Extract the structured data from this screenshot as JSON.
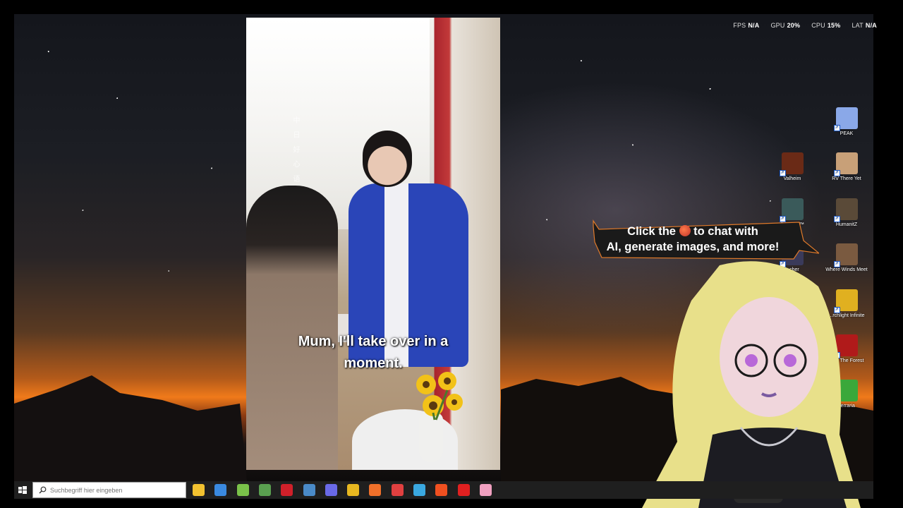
{
  "hud": {
    "fps_label": "FPS",
    "fps_value": "N/A",
    "gpu_label": "GPU",
    "gpu_value": "20%",
    "cpu_label": "CPU",
    "cpu_value": "15%",
    "lat_label": "LAT",
    "lat_value": "N/A"
  },
  "video": {
    "subtitle_line1": "Mum, I'll take over in a",
    "subtitle_line2": "moment.",
    "vertical_text": "中 日 好 心 语"
  },
  "desktop_icons": [
    {
      "label": "PEAK",
      "color": "#8aa8e8"
    },
    {
      "label": "Valheim",
      "color": "#6a2a16"
    },
    {
      "label": "RV There Yet",
      "color": "#c8a078"
    },
    {
      "label": "Returnal™",
      "color": "#3a5a5a"
    },
    {
      "label": "HumanitZ",
      "color": "#5a4a38"
    },
    {
      "label": "...cher",
      "color": "#3a3a5a"
    },
    {
      "label": "Where Winds Meet",
      "color": "#7a5a40"
    },
    {
      "label": "...rchlight Infinite",
      "color": "#e0b020"
    },
    {
      "label": "...Of The Forest",
      "color": "#b01a1a"
    },
    {
      "label": "Terraria",
      "color": "#3aa83a"
    }
  ],
  "assistant": {
    "bubble_line1_a": "Click the",
    "bubble_line1_b": "to chat with",
    "bubble_line2": "AI, generate images, and more!",
    "bubble_icon": "basketball-icon"
  },
  "taskbar": {
    "search_placeholder": "Suchbegriff hier eingeben",
    "apps": [
      {
        "name": "file-explorer-icon",
        "color": "#f2c230"
      },
      {
        "name": "store-icon",
        "color": "#3a8ae0"
      },
      {
        "name": "android-icon",
        "color": "#7ac24a"
      },
      {
        "name": "package-icon",
        "color": "#5aa050"
      },
      {
        "name": "news-icon",
        "color": "#d0202a"
      },
      {
        "name": "steam-icon",
        "color": "#4a8ac8"
      },
      {
        "name": "discord-icon",
        "color": "#6a6ae8"
      },
      {
        "name": "chrome-icon",
        "color": "#e8b820"
      },
      {
        "name": "firefox-icon",
        "color": "#f0702a"
      },
      {
        "name": "speedometer-icon",
        "color": "#e04040"
      },
      {
        "name": "swirl-app-icon",
        "color": "#3aa8e0"
      },
      {
        "name": "brave-icon",
        "color": "#f05020"
      },
      {
        "name": "opera-icon",
        "color": "#e02020"
      },
      {
        "name": "pink-app-icon",
        "color": "#f0a0c0"
      }
    ]
  }
}
